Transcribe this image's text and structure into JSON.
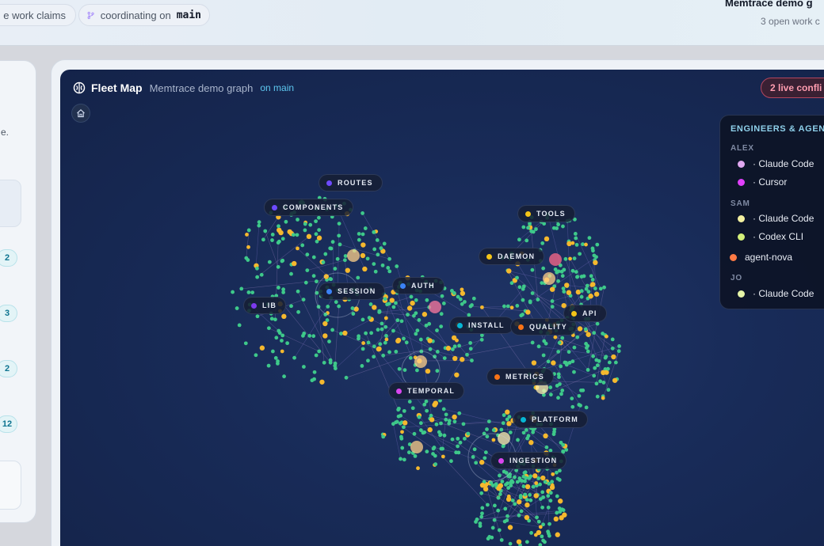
{
  "topbar": {
    "claims_label": "e work claims",
    "branch_prefix": "coordinating on",
    "branch_name": "main",
    "right_title": "Memtrace demo g",
    "right_subtitle": "3 open work c"
  },
  "left_panel": {
    "text": "e.",
    "badges": [
      "2",
      "3",
      "2",
      "12"
    ]
  },
  "map": {
    "title": "Fleet Map",
    "subtitle": "Memtrace demo graph",
    "branch": "on main",
    "conflicts": "2 live confli",
    "clusters": [
      {
        "label": "ROUTES",
        "color": "#6d4aff"
      },
      {
        "label": "COMPONENTS",
        "color": "#6d4aff"
      },
      {
        "label": "TOOLS",
        "color": "#f5c518"
      },
      {
        "label": "DAEMON",
        "color": "#f5c518"
      },
      {
        "label": "AUTH",
        "color": "#3b82f6"
      },
      {
        "label": "SESSION",
        "color": "#3b82f6"
      },
      {
        "label": "LIB",
        "color": "#7c3aed"
      },
      {
        "label": "INSTALL",
        "color": "#06b6d4"
      },
      {
        "label": "QUALITY",
        "color": "#f97316"
      },
      {
        "label": "API",
        "color": "#f5c518"
      },
      {
        "label": "METRICS",
        "color": "#f97316"
      },
      {
        "label": "TEMPORAL",
        "color": "#d946ef"
      },
      {
        "label": "PLATFORM",
        "color": "#06b6d4"
      },
      {
        "label": "INGESTION",
        "color": "#d946ef"
      }
    ]
  },
  "legend": {
    "heading": "ENGINEERS & AGENT",
    "groups": {
      "alex": "ALEX",
      "sam": "SAM",
      "jo": "JO"
    },
    "items": {
      "alex_claude": {
        "label": "· Claude Code",
        "color": "#e0a8f0"
      },
      "alex_cursor": {
        "label": "· Cursor",
        "color": "#e040fb"
      },
      "sam_claude": {
        "label": "· Claude Code",
        "color": "#f3f0a0"
      },
      "sam_codex": {
        "label": "· Codex CLI",
        "color": "#d4f07a"
      },
      "nova": {
        "label": "agent-nova",
        "color": "#ff7a45"
      },
      "jo_claude": {
        "label": "· Claude Code",
        "color": "#e6f5a8"
      }
    }
  }
}
